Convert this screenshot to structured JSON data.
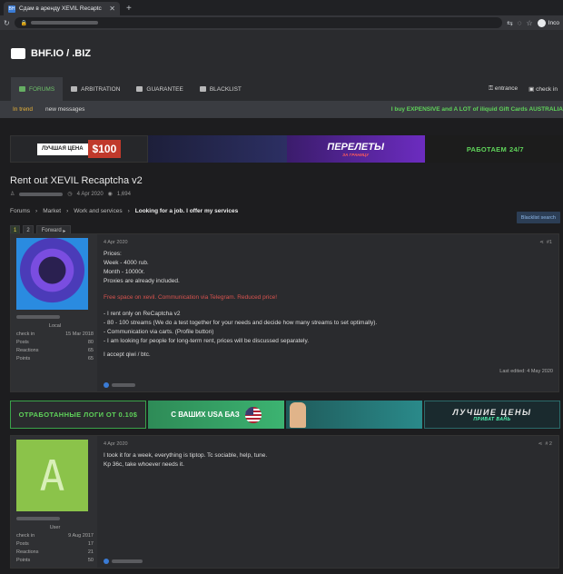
{
  "browser": {
    "tab_title": "Сдам в аренду XEVIL Recaptc",
    "tab_favicon": "BH",
    "profile_label": "Inco"
  },
  "site": {
    "logo": "BHF.IO / .BIZ",
    "nav": {
      "forums": "FORUMS",
      "arbitration": "ARBITRATION",
      "guarantee": "GUARANTEE",
      "blacklist": "BLACKLIST",
      "entrance": "entrance",
      "checkin": "check in"
    },
    "subnav": {
      "in_trend": "In trend",
      "new_messages": "new messages",
      "marquee": "I buy EXPENSIVE and A LOT of iliquid Gift Cards AUSTRALIA"
    }
  },
  "banners": {
    "b1_small": "ЛУЧШАЯ ЦЕНА",
    "b1_price": "$100",
    "b3_title": "ПЕРЕЛЕТЫ",
    "b3_sub": "ЗА ГРАНИЦУ",
    "b4_text": "РАБОТАЕМ",
    "b4_accent": "24/7"
  },
  "thread": {
    "title": "Rent out XEVIL Recaptcha v2",
    "date": "4 Apr 2020",
    "views": "1,694",
    "breadcrumbs": [
      "Forums",
      "Market",
      "Work and services",
      "Looking for a job. I offer my services"
    ],
    "pages": [
      "1",
      "2"
    ],
    "forward": "Forward",
    "blacklist_search": "Blacklist search"
  },
  "posts": [
    {
      "role": "Local",
      "stats": [
        {
          "label": "check in",
          "value": "15 Mar 2018"
        },
        {
          "label": "Posts",
          "value": "80"
        },
        {
          "label": "Reactions",
          "value": "65"
        },
        {
          "label": "Points",
          "value": "65"
        }
      ],
      "date": "4 Apr 2020",
      "num": "#1",
      "lines": {
        "prices": "Prices:",
        "week": "Week - 4000 rub.",
        "month": "Month - 10000r.",
        "proxies": "Proxies are already included.",
        "free": "Free space on xevil. Communication via Telegram. Reduced price!",
        "rent": "- I rent only on ReCaptcha v2",
        "streams": "- 80 - 100 streams (We do a test together for your needs and decide how many streams to set optimally).",
        "comm": "- Communication via carts. (Profile button)",
        "longterm": "- I am looking for people for long-term rent, prices will be discussed separately.",
        "accept": "I accept qiwi / btc."
      },
      "last_edited": "Last edited: 4 May 2020"
    },
    {
      "avatar_letter": "A",
      "role": "User",
      "stats": [
        {
          "label": "check in",
          "value": "9 Aug 2017"
        },
        {
          "label": "Posts",
          "value": "17"
        },
        {
          "label": "Reactions",
          "value": "21"
        },
        {
          "label": "Points",
          "value": "50"
        }
      ],
      "date": "4 Apr 2020",
      "num": "# 2",
      "lines": {
        "l1": "I took it for a week, everything is tiptop. Tc sociable, help, tune.",
        "l2": "Kp 36c, take whoever needs it."
      }
    }
  ],
  "ads": {
    "a1": "ОТРАБОТАННЫЕ ЛОГИ ОТ 0.10$",
    "a2": "С ВАШИХ USA БАЗ",
    "a4": "ЛУЧШИЕ ЦЕНЫ",
    "a4_sub": "ПРИВАТ ВАНЬ"
  }
}
